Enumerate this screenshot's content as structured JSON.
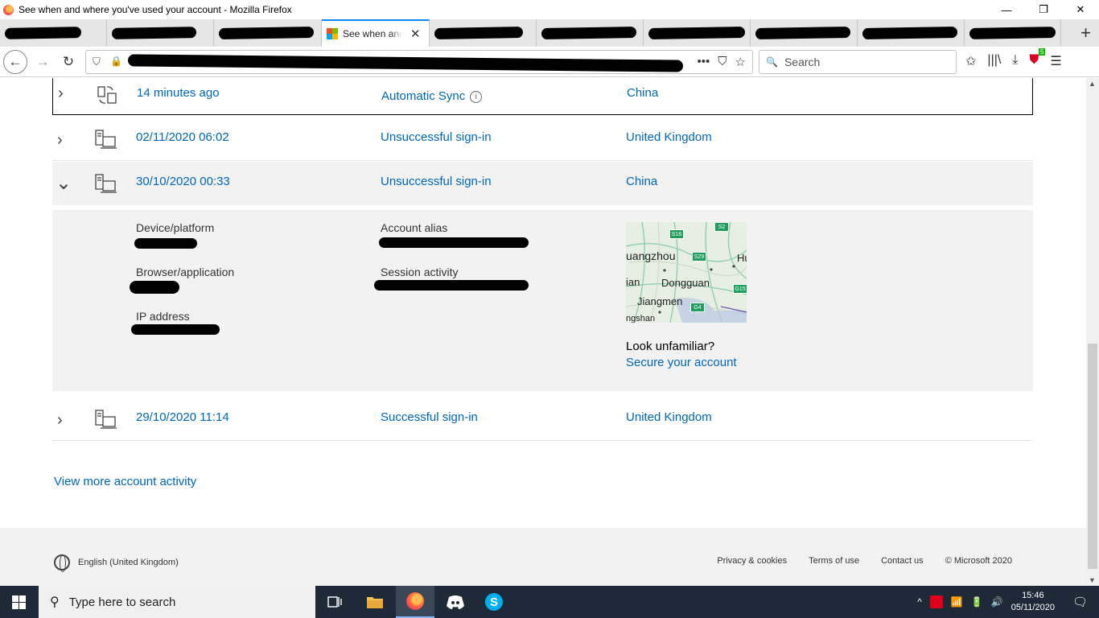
{
  "window": {
    "title": "See when and where you've used your account - Mozilla Firefox",
    "min": "—",
    "max": "❐",
    "close": "✕"
  },
  "tabs": {
    "active_title": "See when and where you've used your account",
    "close_glyph": "✕",
    "new_tab_glyph": "+"
  },
  "nav": {
    "back": "←",
    "forward": "→",
    "reload": "↻",
    "url_icons": [
      "•••",
      "⛉",
      "☆"
    ],
    "search_placeholder": "Search",
    "search_glyph": "🔍",
    "tool_icons": [
      "✩",
      "|||\\",
      "⤓",
      "☰"
    ],
    "shield_badge": "5"
  },
  "activity": {
    "rows": [
      {
        "date": "14 minutes ago",
        "type": "Automatic Sync",
        "location": "China",
        "info_glyph": "i",
        "chevron": "›"
      },
      {
        "date": "02/11/2020 06:02",
        "type": "Unsuccessful sign-in",
        "location": "United Kingdom",
        "chevron": "›"
      },
      {
        "date": "30/10/2020 00:33",
        "type": "Unsuccessful sign-in",
        "location": "China",
        "chevron": "⌄"
      },
      {
        "date": "29/10/2020 11:14",
        "type": "Successful sign-in",
        "location": "United Kingdom",
        "chevron": "›"
      }
    ],
    "details": {
      "device_label": "Device/platform",
      "browser_label": "Browser/application",
      "ip_label": "IP address",
      "alias_label": "Account alias",
      "session_label": "Session activity",
      "map_labels": [
        "uangzhou",
        "Dongguan",
        "Jiangmen",
        "ian",
        "Hu",
        "ngshan"
      ],
      "map_routes": [
        "S16",
        "S2",
        "S29",
        "G15",
        "G4"
      ],
      "look_unfamiliar": "Look unfamiliar?",
      "secure_link": "Secure your account"
    },
    "view_more": "View more account activity"
  },
  "footer": {
    "language": "English (United Kingdom)",
    "links": [
      "Privacy & cookies",
      "Terms of use",
      "Contact us",
      "© Microsoft 2020"
    ]
  },
  "taskbar": {
    "search_placeholder": "Type here to search",
    "time": "15:46",
    "date": "05/11/2020",
    "tray_icons": [
      "^",
      "📶",
      "🔋",
      "🔊",
      "🗨"
    ]
  },
  "colors": {
    "link": "#0067b8",
    "taskbar": "#1f2a38",
    "expanded_bg": "#f2f2f2"
  }
}
